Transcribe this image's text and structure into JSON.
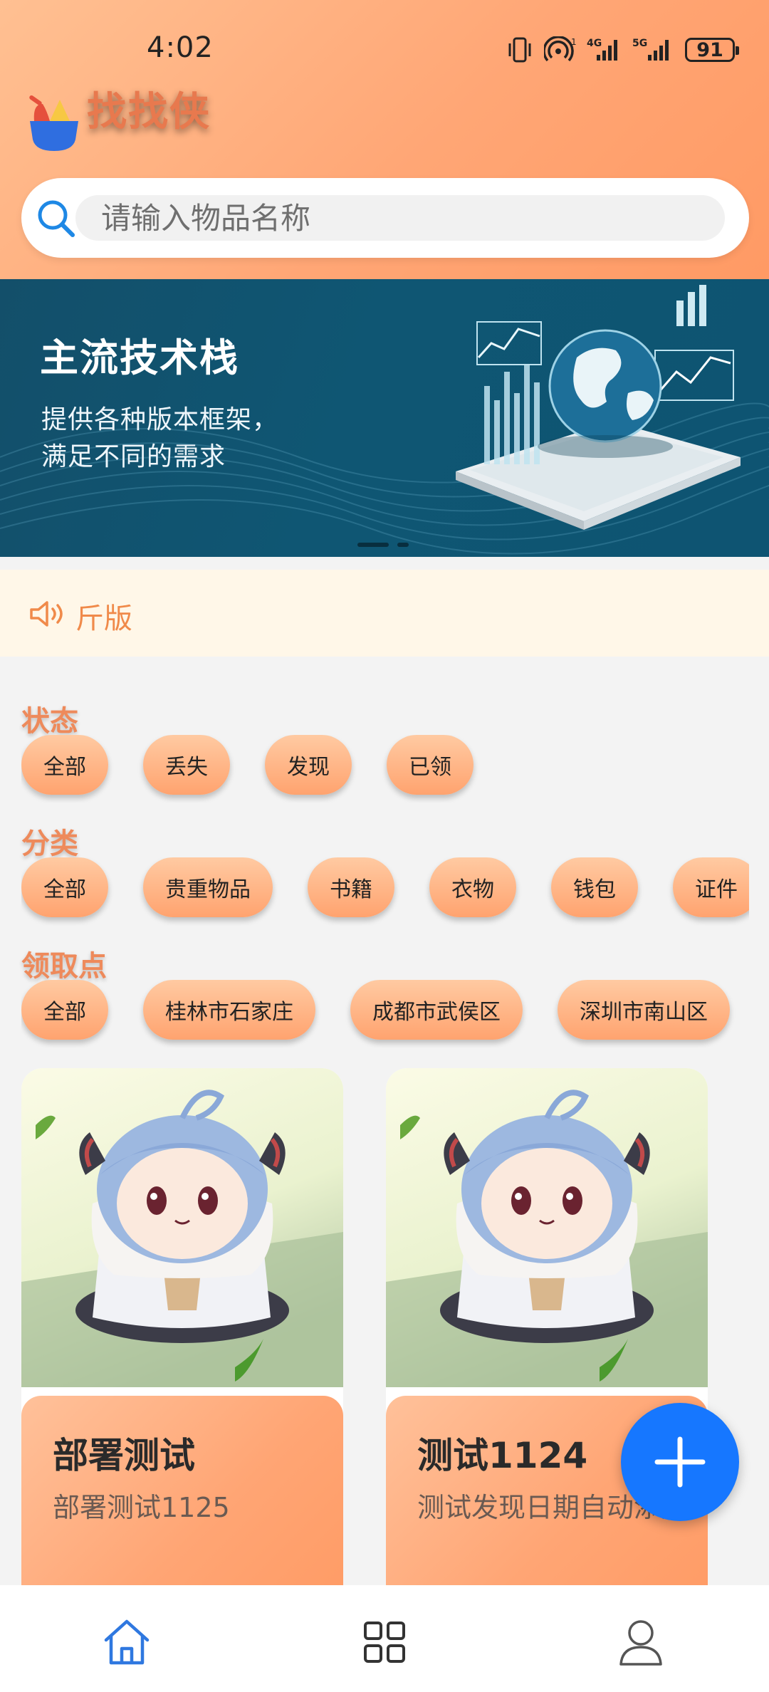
{
  "status_bar": {
    "time": "4:02",
    "battery": "91",
    "icons": [
      "vibrate-icon",
      "hotspot-icon",
      "signal-4g-icon",
      "signal-5g-icon",
      "battery-icon"
    ]
  },
  "app": {
    "name": "找找侠",
    "logo": "bowl-logo-icon"
  },
  "search": {
    "placeholder": "请输入物品名称",
    "value": ""
  },
  "banner": {
    "title": "主流技术栈",
    "subtitle_line1": "提供各种版本框架，",
    "subtitle_line2": "满足不同的需求",
    "slides": 2,
    "active_slide": 1
  },
  "notice": {
    "icon": "speaker-icon",
    "text": "斤版"
  },
  "filters": {
    "status": {
      "title": "状态",
      "options": [
        "全部",
        "丢失",
        "发现",
        "已领"
      ]
    },
    "category": {
      "title": "分类",
      "options": [
        "全部",
        "贵重物品",
        "书籍",
        "衣物",
        "钱包",
        "证件"
      ]
    },
    "pickup": {
      "title": "领取点",
      "options": [
        "全部",
        "桂林市石家庄",
        "成都市武侯区",
        "深圳市南山区"
      ]
    }
  },
  "items": [
    {
      "title": "部署测试",
      "desc": "部署测试1125"
    },
    {
      "title": "测试1124",
      "desc": "测试发现日期自动添加"
    }
  ],
  "fab": {
    "icon": "plus-icon"
  },
  "nav": {
    "items": [
      "home-icon",
      "grid-icon",
      "user-icon"
    ],
    "active": "home-icon"
  },
  "colors": {
    "accent": "#ffa675",
    "primary_blue": "#1677ff",
    "notice_text": "#f08a4a",
    "filter_title": "#ee8a5b"
  }
}
